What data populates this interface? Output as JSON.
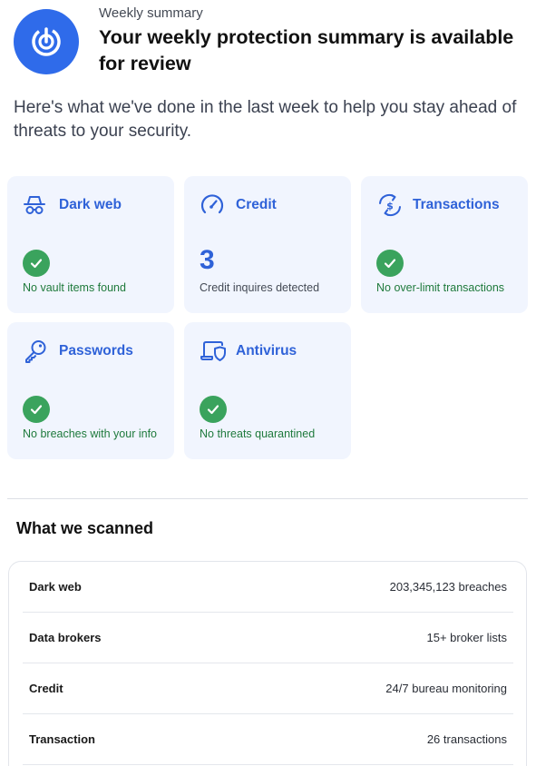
{
  "header": {
    "kicker": "Weekly summary",
    "title": "Your weekly protection summary is available for review",
    "logo_icon": "shield-power-icon"
  },
  "intro": "Here's what we've done in the last week to help you stay ahead of threats to your security.",
  "cards": [
    {
      "title": "Dark web",
      "icon": "spy-icon",
      "status": "No vault items found",
      "indicator": "check"
    },
    {
      "title": "Credit",
      "icon": "gauge-icon",
      "value": "3",
      "status": "Credit inquires detected",
      "indicator": "number"
    },
    {
      "title": "Transactions",
      "icon": "dollar-exchange-icon",
      "status": "No over-limit transactions",
      "indicator": "check"
    },
    {
      "title": "Passwords",
      "icon": "key-icon",
      "status": "No breaches with your info",
      "indicator": "check"
    },
    {
      "title": "Antivirus",
      "icon": "laptop-shield-icon",
      "status": "No threats quarantined",
      "indicator": "check"
    }
  ],
  "scanned": {
    "title": "What we scanned",
    "rows": [
      {
        "label": "Dark web",
        "value": "203,345,123 breaches"
      },
      {
        "label": "Data brokers",
        "value": "15+ broker lists"
      },
      {
        "label": "Credit",
        "value": "24/7 bureau monitoring"
      },
      {
        "label": "Transaction",
        "value": "26 transactions"
      }
    ]
  },
  "colors": {
    "brand_blue": "#2f6bea",
    "card_bg": "#f1f5fe",
    "success_green": "#3aa35d",
    "status_text_green": "#1f7a3c"
  }
}
